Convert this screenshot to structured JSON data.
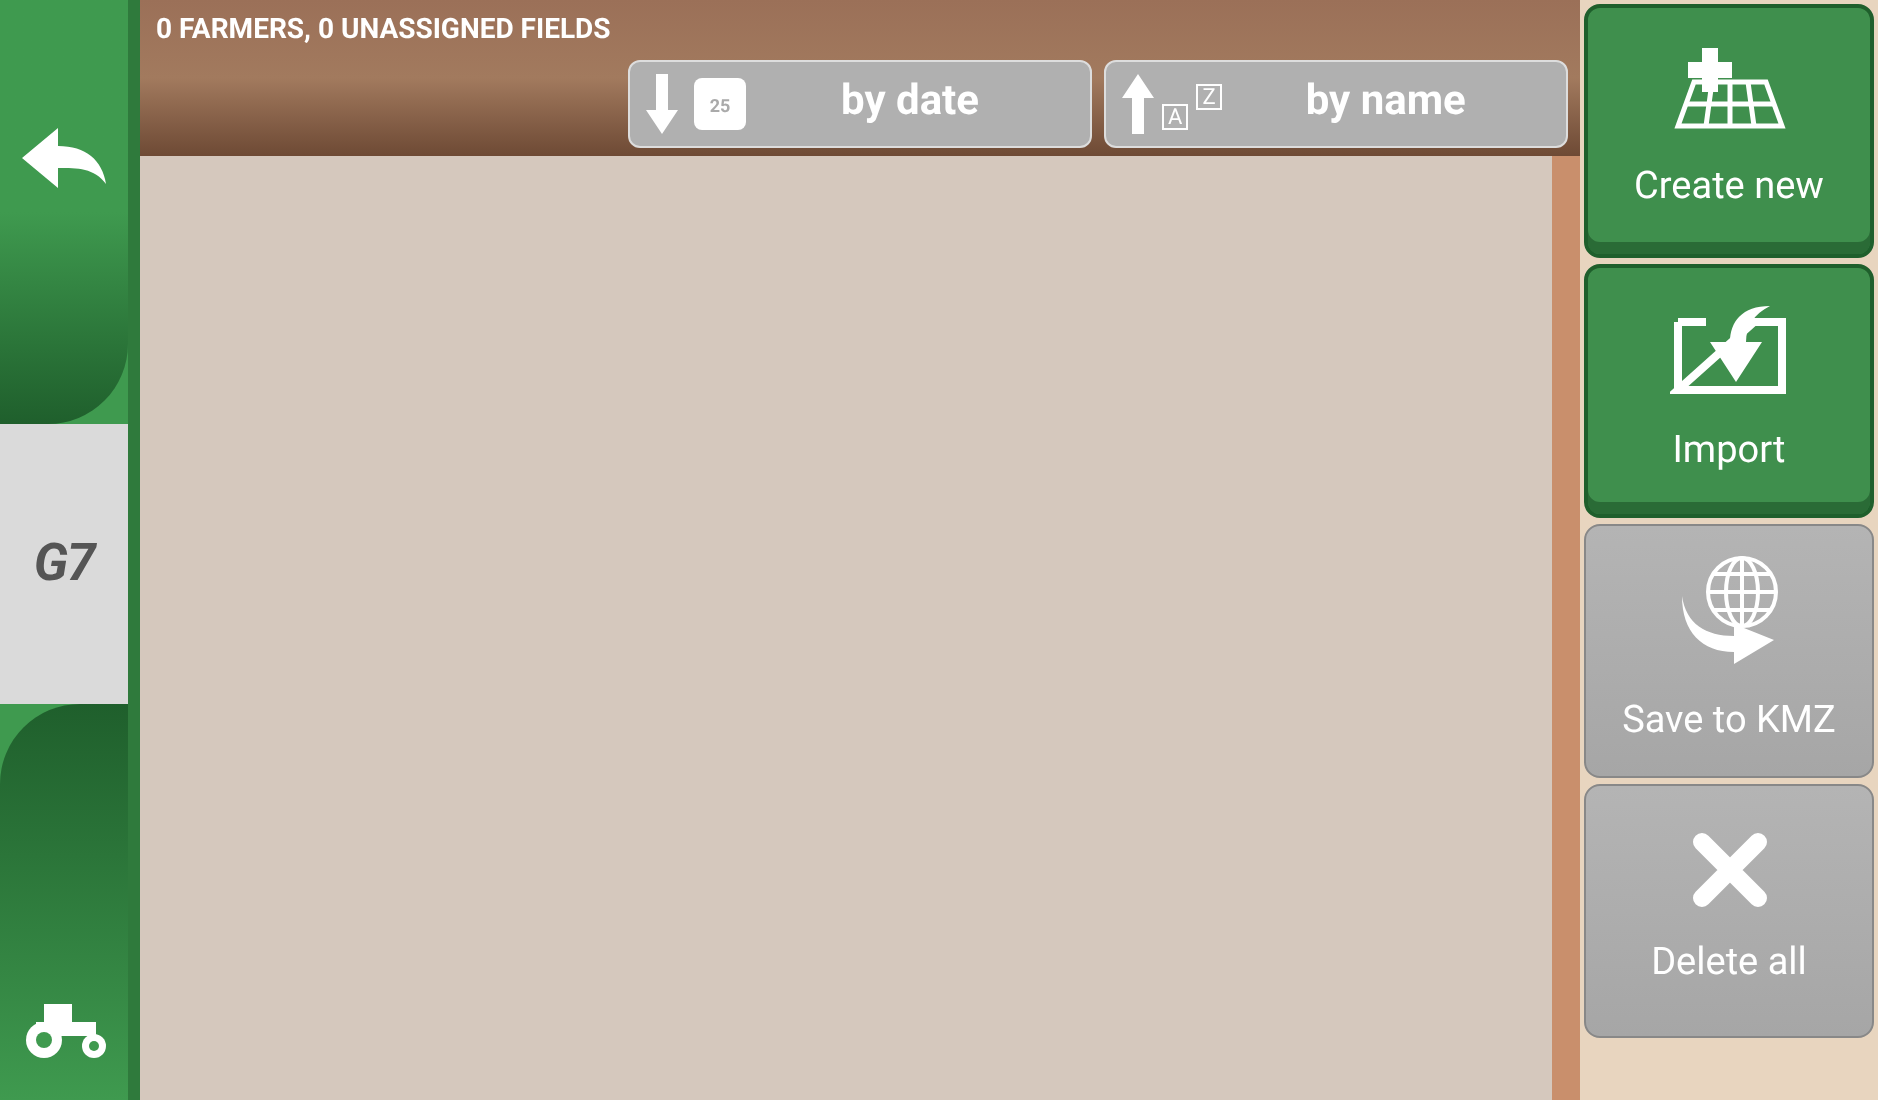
{
  "sidebar": {
    "logo": "G7"
  },
  "header": {
    "summary": "0 FARMERS, 0 UNASSIGNED FIELDS"
  },
  "sort_buttons": [
    {
      "kind": "date",
      "label": "by date",
      "calendar_day": "25"
    },
    {
      "kind": "name",
      "label": "by name",
      "letter_a": "A",
      "letter_z": "Z"
    }
  ],
  "actions": [
    {
      "kind": "create",
      "label": "Create new",
      "disabled": false
    },
    {
      "kind": "import",
      "label": "Import",
      "disabled": false
    },
    {
      "kind": "kmz",
      "label": "Save to KMZ",
      "disabled": true
    },
    {
      "kind": "delete",
      "label": "Delete all",
      "disabled": true
    }
  ]
}
